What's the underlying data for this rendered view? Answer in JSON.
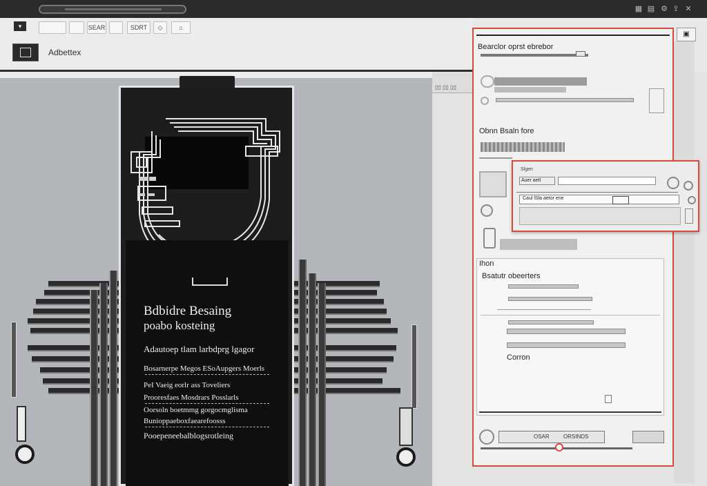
{
  "app": {
    "name": "Adbettex",
    "toolbar_buttons": [
      "",
      "",
      "SEAR",
      "",
      "",
      "",
      "SDRT"
    ]
  },
  "poster": {
    "title_line1": "Bdbidre Besaing",
    "title_line2": "poabo kosteing",
    "subtitle": "Adautoep tlam larbdprg lgagor",
    "lines": [
      "Bosarnerpe Megos ESoAupgers Moerls",
      "PeI Vaeig eorlr ass Toveliers",
      "Prooresfaes Mosdrars Posslarls",
      "Oorsoln boetmmg gorgocmglisma",
      "Bunioppaeboxfaearefoosss",
      "Pooepeneebalblogsrotleing"
    ]
  },
  "panel": {
    "section1_title": "Bearclor oprst ebrebor",
    "section2_title": "Obnn Bsaln fore",
    "section3_title": "Ihon",
    "section3_sub": "Bsatutr obeerters",
    "confirm_label": "Corron",
    "footer_label": "OSAR",
    "footer_button": "ORSINDS"
  },
  "popup": {
    "label": "Slgen",
    "field_label": "Auer aetl",
    "row_label": "Caul lSla aetor ene"
  },
  "colors": {
    "highlight": "#d54a3a",
    "titlebar": "#2b2b2b",
    "canvas": "#b3b6ba",
    "poster": "#1d1d1d"
  }
}
